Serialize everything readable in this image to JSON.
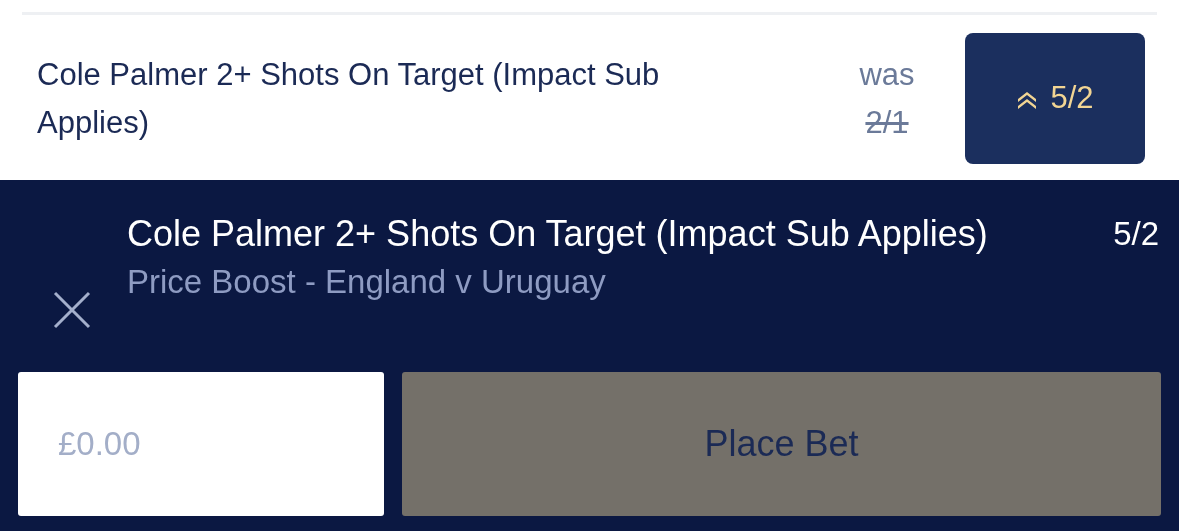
{
  "selection": {
    "name": "Cole Palmer 2+ Shots On Target (Impact Sub Applies)",
    "was_label": "was",
    "was_price": "2/1",
    "boosted_price": "5/2"
  },
  "bet_slip": {
    "name": "Cole Palmer 2+ Shots On Target (Impact Sub Applies)",
    "odds": "5/2",
    "subtitle": "Price Boost - England v Uruguay",
    "stake": {
      "placeholder": "£0.00"
    },
    "place_bet": {
      "label": "Place Bet",
      "disabled": true
    }
  }
}
